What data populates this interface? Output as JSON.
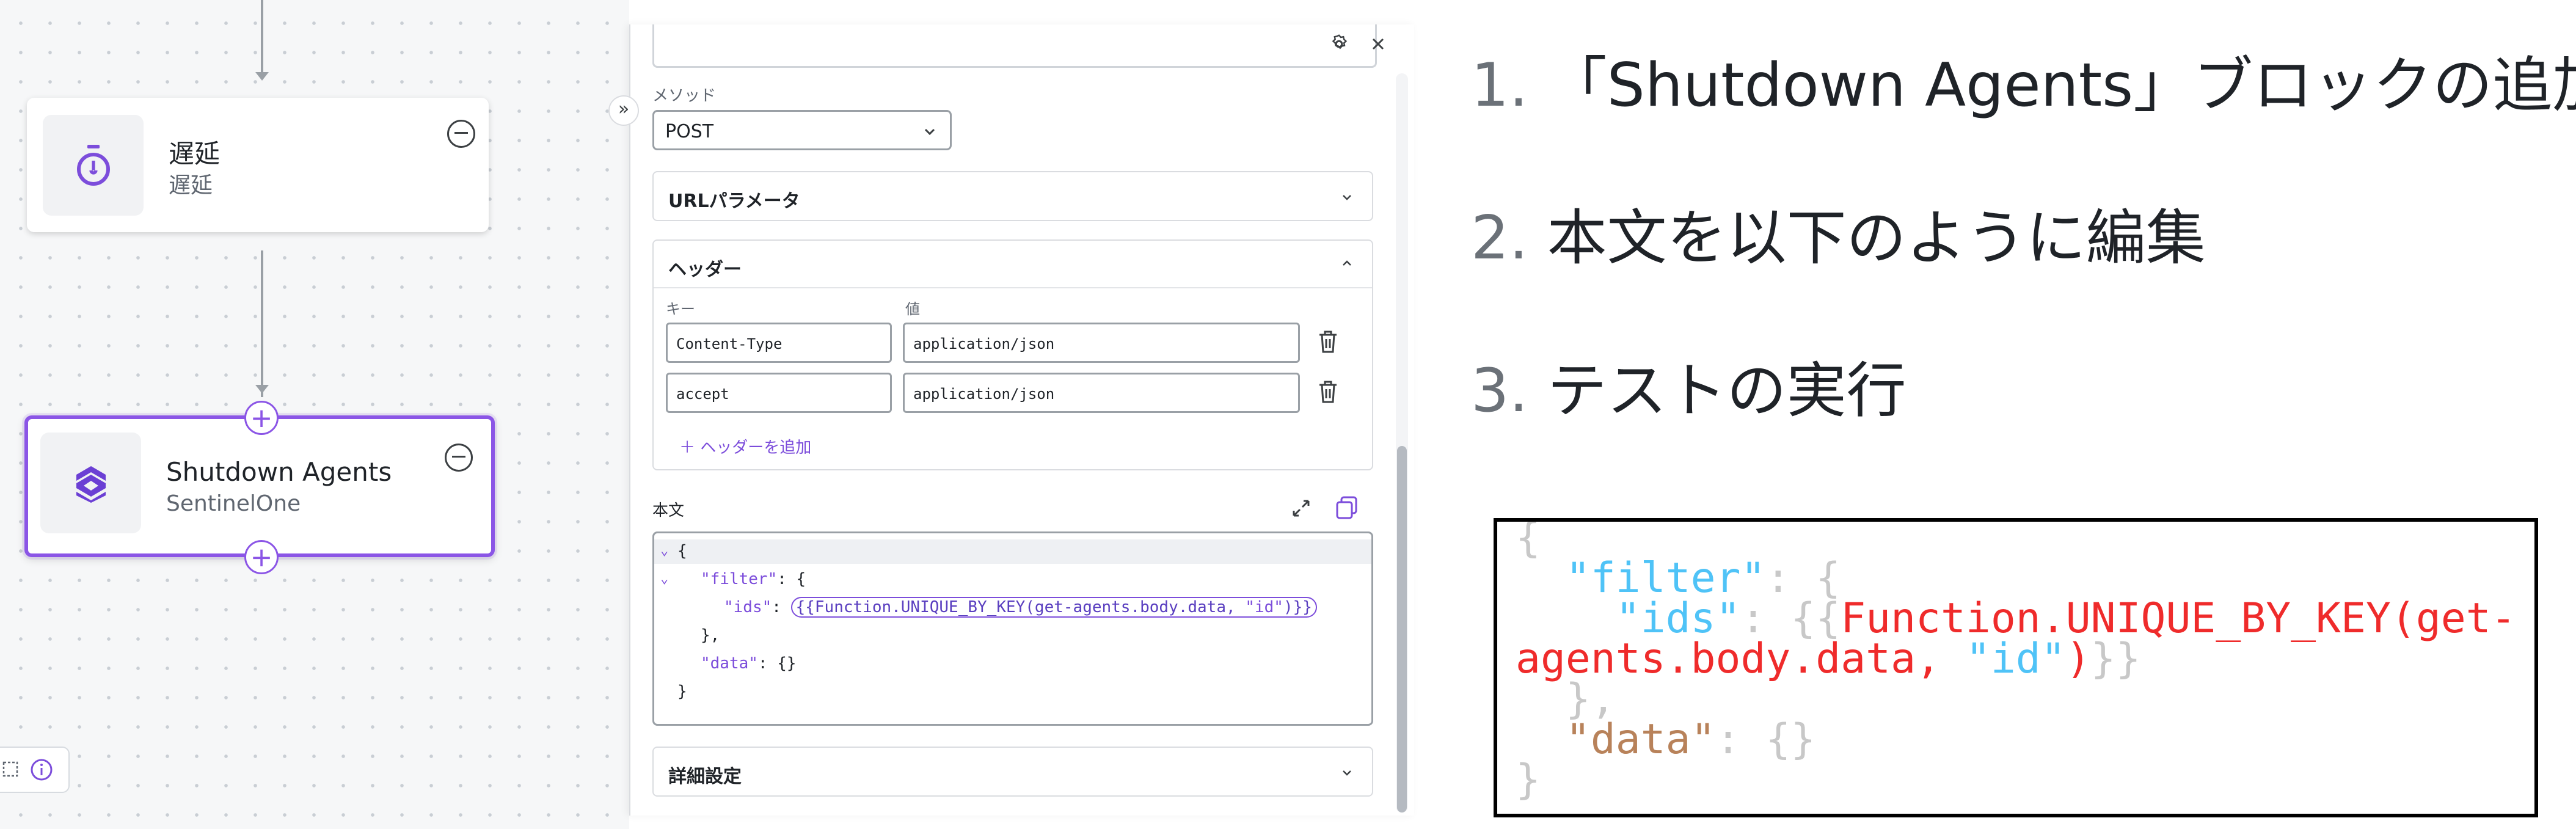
{
  "canvas": {
    "nodes": [
      {
        "title": "遅延",
        "subtitle": "遅延",
        "icon": "timer-icon"
      },
      {
        "title": "Shutdown Agents",
        "subtitle": "SentinelOne",
        "icon": "sentinelone-logo-icon",
        "selected": true
      }
    ],
    "plus_symbol": "+"
  },
  "panel": {
    "collapse_symbol": "»",
    "method_label": "メソッド",
    "method_value": "POST",
    "url_params_label": "URLパラメータ",
    "headers_label": "ヘッダー",
    "key_column": "キー",
    "value_column": "値",
    "headers": [
      {
        "key": "Content-Type",
        "value": "application/json"
      },
      {
        "key": "accept",
        "value": "application/json"
      }
    ],
    "add_header": "＋ ヘッダーを追加",
    "body_label": "本文",
    "code": {
      "l1": "{",
      "l2_key": "\"filter\"",
      "l2_rest": ": {",
      "l3_key": "\"ids\"",
      "l3_colon": ": ",
      "l3_fn": "{{Function.UNIQUE_BY_KEY(get-agents.body.data, ",
      "l3_str": "\"id\"",
      "l3_end": ")}}",
      "l4": "},",
      "l5_key": "\"data\"",
      "l5_rest": ": {}",
      "l6": "}"
    },
    "advanced_label": "詳細設定"
  },
  "instructions": [
    {
      "num": "1.",
      "text": "「Shutdown Agents」ブロックの追加"
    },
    {
      "num": "2.",
      "text": "本文を以下のように編集"
    },
    {
      "num": "3.",
      "text": "テストの実行"
    }
  ],
  "example": {
    "open": "{",
    "filter_key": "\"filter\"",
    "filter_rest": ": {",
    "ids_key": "\"ids\"",
    "ids_rest": ": {{",
    "fn_part1": "Function.UNIQUE_BY_KEY(get-",
    "fn_part2": "agents.body.data, ",
    "id_str": "\"id\"",
    "fn_close": ")",
    "braces_close": "}}",
    "inner_close": "},",
    "data_key": "\"data\"",
    "data_rest": ": {}",
    "close": "}"
  },
  "colors": {
    "accent": "#8b55e6",
    "example_key": "#4fc3f7",
    "example_fn": "#ef2b2b",
    "example_data": "#b8825a"
  }
}
